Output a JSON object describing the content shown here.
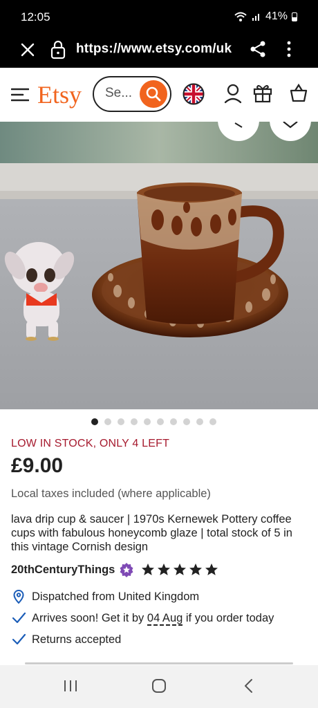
{
  "status_bar": {
    "time": "12:05",
    "battery": "41%"
  },
  "browser": {
    "url": "https://www.etsy.com/uk"
  },
  "header": {
    "logo": "Etsy",
    "search_placeholder": "Se..."
  },
  "carousel": {
    "total": 10,
    "active_index": 0
  },
  "product": {
    "stock_notice": "LOW IN STOCK, ONLY 4 LEFT",
    "price": "£9.00",
    "taxes_note": "Local taxes included (where applicable)",
    "title": "lava drip cup & saucer | 1970s Kernewek Pottery coffee cups with fabulous honeycomb glaze | total stock of 5 in this vintage Cornish design",
    "shop_name": "20thCenturyThings",
    "rating_stars": 5
  },
  "shipping": {
    "dispatch": "Dispatched from United Kingdom",
    "arrives_prefix": "Arrives soon! Get it by ",
    "arrives_date": "04 Aug",
    "arrives_suffix": " if you order today",
    "returns": "Returns accepted"
  },
  "colors": {
    "brand": "#f1641e",
    "stock_red": "#a61a2e",
    "star_seller": "#7f4ab5"
  },
  "icons": [
    "close-icon",
    "lock-icon",
    "share-icon",
    "more-icon",
    "menu-icon",
    "search-icon",
    "uk-flag-icon",
    "user-icon",
    "gift-icon",
    "bag-icon",
    "location-pin-icon",
    "check-icon",
    "star-seller-icon",
    "star-icon"
  ]
}
